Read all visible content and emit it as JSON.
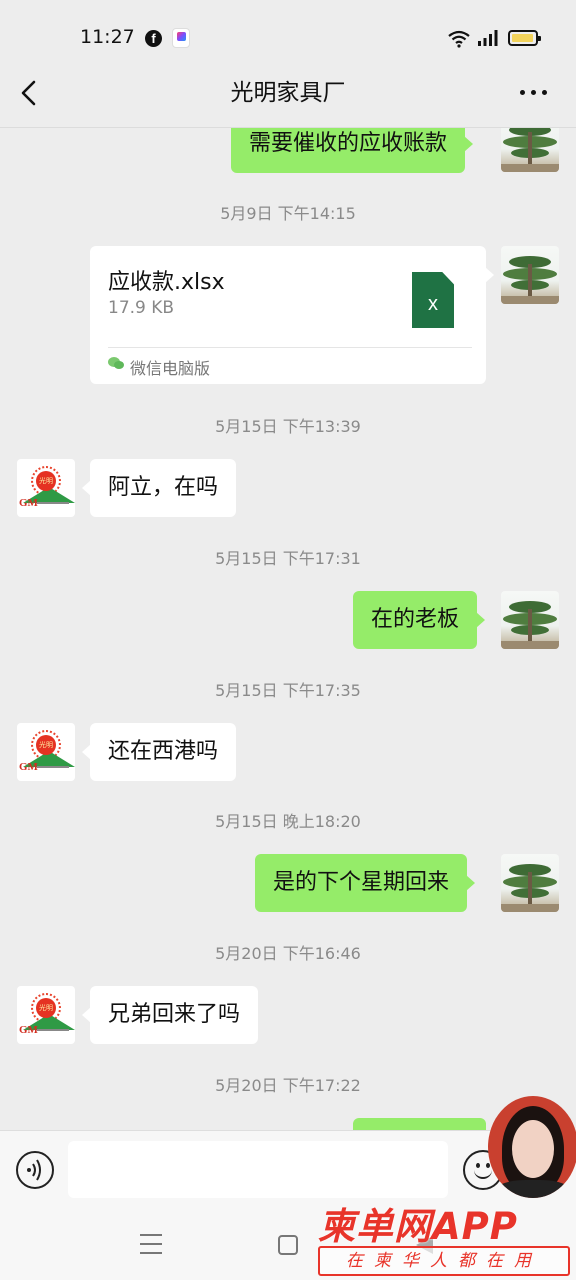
{
  "status_bar": {
    "time": "11:27",
    "icons": [
      "facebook-icon",
      "app-icon",
      "wifi-icon",
      "signal-icon",
      "battery-icon"
    ]
  },
  "header": {
    "title": "光明家具厂",
    "back_icon": "chevron-left-icon",
    "more_icon": "more-dots-icon"
  },
  "chat": {
    "messages": [
      {
        "type": "text",
        "sender": "me",
        "text": "需要催收的应收账款"
      },
      {
        "type": "timestamp",
        "text": "5月9日 下午14:15"
      },
      {
        "type": "file",
        "sender": "me",
        "file_name": "应收款.xlsx",
        "file_size": "17.9 KB",
        "source": "微信电脑版"
      },
      {
        "type": "timestamp",
        "text": "5月15日 下午13:39"
      },
      {
        "type": "text",
        "sender": "other",
        "text": "阿立，在吗"
      },
      {
        "type": "timestamp",
        "text": "5月15日 下午17:31"
      },
      {
        "type": "text",
        "sender": "me",
        "text": "在的老板"
      },
      {
        "type": "timestamp",
        "text": "5月15日 下午17:35"
      },
      {
        "type": "text",
        "sender": "other",
        "text": "还在西港吗"
      },
      {
        "type": "timestamp",
        "text": "5月15日 晚上18:20"
      },
      {
        "type": "text",
        "sender": "me",
        "text": "是的下个星期回来"
      },
      {
        "type": "timestamp",
        "text": "5月20日 下午16:46"
      },
      {
        "type": "text",
        "sender": "other",
        "text": "兄弟回来了吗"
      },
      {
        "type": "timestamp",
        "text": "5月20日 下午17:22"
      }
    ]
  },
  "input_bar": {
    "value": "",
    "voice_icon": "voice-icon",
    "emoji_icon": "emoji-icon"
  },
  "watermark": {
    "title": "柬单网APP",
    "tagline": "在柬华人都在用"
  },
  "colors": {
    "my_bubble": "#95ec69",
    "other_bubble": "#ffffff",
    "background": "#ededed",
    "watermark": "#e8342a"
  }
}
